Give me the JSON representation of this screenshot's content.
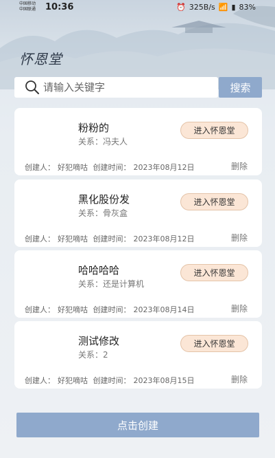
{
  "status_bar": {
    "carrier1": "中国移动",
    "carrier2": "中国联通",
    "time": "10:36",
    "speed": "325B/s",
    "battery": "83%"
  },
  "header": {
    "logo": "怀恩堂"
  },
  "search": {
    "placeholder": "请输入关键字",
    "button_label": "搜索"
  },
  "labels": {
    "relation_prefix": "关系：",
    "creator_prefix": "创建人：",
    "created_time_prefix": "创建时间：",
    "enter_button": "进入怀恩堂",
    "delete": "删除"
  },
  "records": [
    {
      "name": "粉粉的",
      "relation": "冯夫人",
      "creator": "好犯嘀咕",
      "created": "2023年08月12日"
    },
    {
      "name": "黑化股份发",
      "relation": "骨灰盒",
      "creator": "好犯嘀咕",
      "created": "2023年08月12日"
    },
    {
      "name": "哈哈哈哈",
      "relation": "还是计算机",
      "creator": "好犯嘀咕",
      "created": "2023年08月14日"
    },
    {
      "name": "测试修改",
      "relation": "2",
      "creator": "好犯嘀咕",
      "created": "2023年08月15日"
    }
  ],
  "footer": {
    "create_button": "点击创建"
  },
  "colors": {
    "accent": "#8fa9cc",
    "enter_button_bg": "#fbe6d6"
  }
}
